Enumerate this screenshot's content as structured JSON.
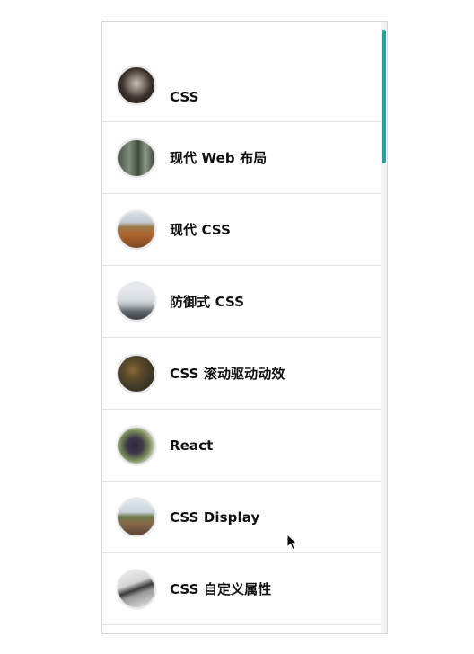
{
  "list": {
    "items": [
      {
        "label": "CSS",
        "thumb": "dark-corridor-photo"
      },
      {
        "label": "现代 Web 布局",
        "thumb": "forest-trees-photo"
      },
      {
        "label": "现代 CSS",
        "thumb": "autumn-hills-photo"
      },
      {
        "label": "防御式 CSS",
        "thumb": "misty-lake-rocks-photo"
      },
      {
        "label": "CSS 滚动驱动动效",
        "thumb": "mossy-rocks-photo"
      },
      {
        "label": "React",
        "thumb": "berries-cluster-photo"
      },
      {
        "label": "CSS Display",
        "thumb": "railway-tracks-photo"
      },
      {
        "label": "CSS 自定义属性",
        "thumb": "stone-slab-photo"
      }
    ]
  },
  "colors": {
    "scroll_thumb": "#27a0a0",
    "divider": "#e2e2e2",
    "text": "#111111"
  }
}
